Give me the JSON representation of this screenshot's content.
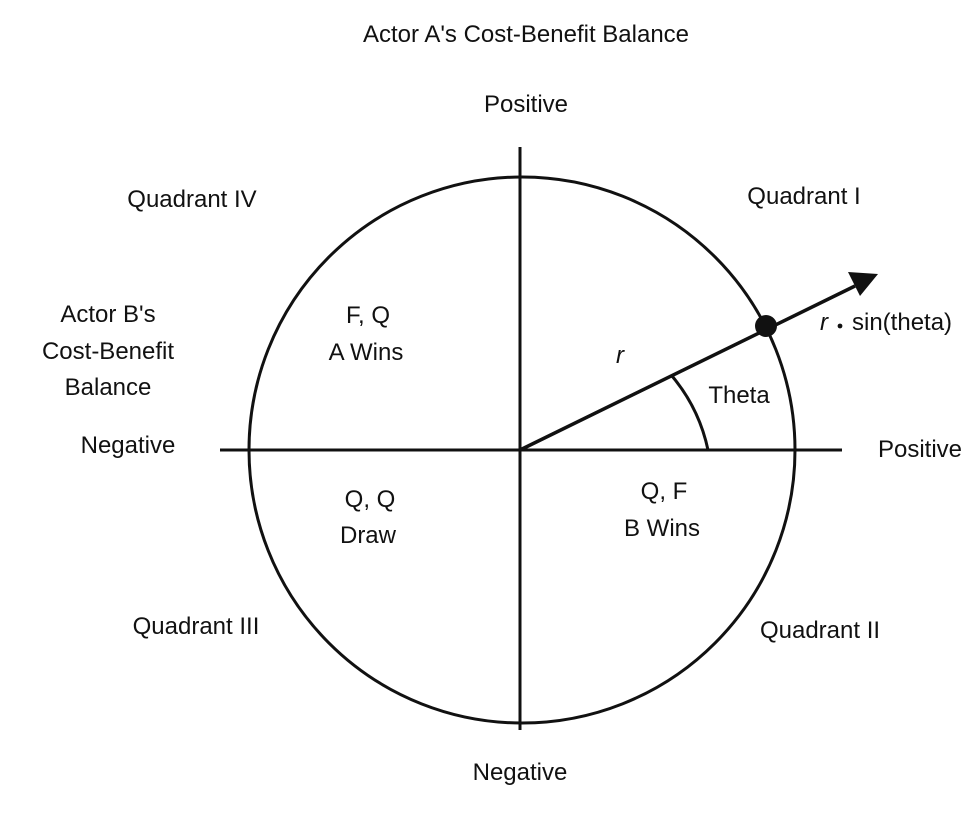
{
  "title": "Actor A's Cost-Benefit Balance",
  "vertical_axis": {
    "top_label": "Positive",
    "bottom_label": "Negative"
  },
  "horizontal_axis": {
    "left_label": "Negative",
    "right_label": "Positive",
    "name_lines": [
      "Actor B's",
      "Cost-Benefit",
      "Balance"
    ]
  },
  "quadrants": {
    "q1": {
      "name": "Quadrant I"
    },
    "q2": {
      "name": "Quadrant II",
      "outcome_lines": [
        "Q, F",
        "B Wins"
      ]
    },
    "q3": {
      "name": "Quadrant III",
      "outcome_lines": [
        "Q, Q",
        "Draw"
      ]
    },
    "q4": {
      "name": "Quadrant IV",
      "outcome_lines": [
        "F, Q",
        "A Wins"
      ]
    }
  },
  "vector": {
    "radius_label": "r",
    "angle_label": "Theta",
    "projection_label_symbol": "r",
    "projection_label_text": "sin(theta)"
  }
}
